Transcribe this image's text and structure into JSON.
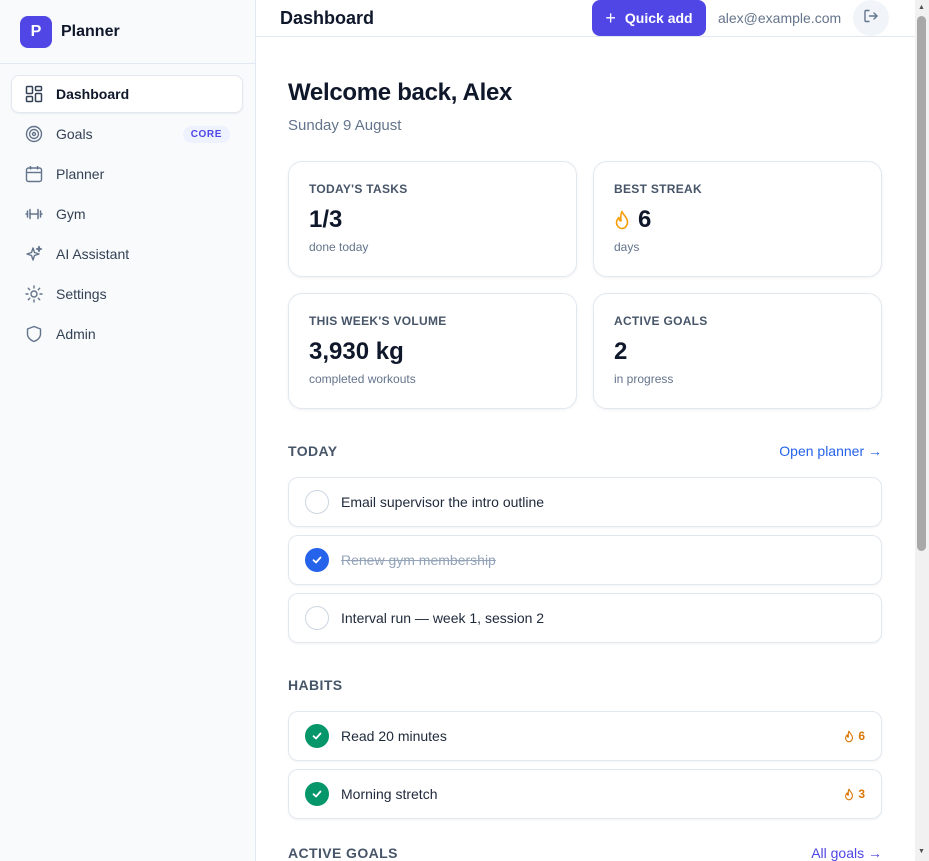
{
  "brand": {
    "logo_letter": "P",
    "name": "Planner",
    "accent": "#4f46e5"
  },
  "sidebar": {
    "items": [
      {
        "label": "Dashboard",
        "icon": "grid-icon",
        "active": true
      },
      {
        "label": "Goals",
        "icon": "target-icon",
        "badge": "CORE"
      },
      {
        "label": "Planner",
        "icon": "calendar-icon"
      },
      {
        "label": "Gym",
        "icon": "dumbbell-icon"
      },
      {
        "label": "AI Assistant",
        "icon": "sparkles-icon"
      },
      {
        "label": "Settings",
        "icon": "gear-icon"
      },
      {
        "label": "Admin",
        "icon": "shield-icon"
      }
    ]
  },
  "header": {
    "title": "Dashboard",
    "quick_add_label": "Quick add",
    "user_email": "alex@example.com"
  },
  "main": {
    "welcome": "Welcome back, Alex",
    "date": "Sunday 9 August",
    "stats": [
      {
        "label": "Today's tasks",
        "value": "1/3",
        "sub": "done today"
      },
      {
        "label": "Best streak",
        "value": "6",
        "sub": "days",
        "icon": "flame-icon"
      },
      {
        "label": "This week's volume",
        "value": "3,930 kg",
        "sub": "completed workouts"
      },
      {
        "label": "Active goals",
        "value": "2",
        "sub": "in progress"
      }
    ],
    "today": {
      "title": "TODAY",
      "link": "Open planner →",
      "tasks": [
        {
          "label": "Email supervisor the intro outline",
          "done": false
        },
        {
          "label": "Renew gym membership",
          "done": true
        },
        {
          "label": "Interval run — week 1, session 2",
          "done": false
        }
      ]
    },
    "habits": {
      "title": "HABITS",
      "items": [
        {
          "label": "Read 20 minutes",
          "streak": "6",
          "done": true
        },
        {
          "label": "Morning stretch",
          "streak": "3",
          "done": true
        }
      ]
    },
    "active_goals": {
      "title": "ACTIVE GOALS",
      "link": "All goals →"
    }
  },
  "colors": {
    "task_done": "#2563eb",
    "habit_done": "#059669",
    "streak": "#d97706",
    "link": "#2563eb"
  }
}
